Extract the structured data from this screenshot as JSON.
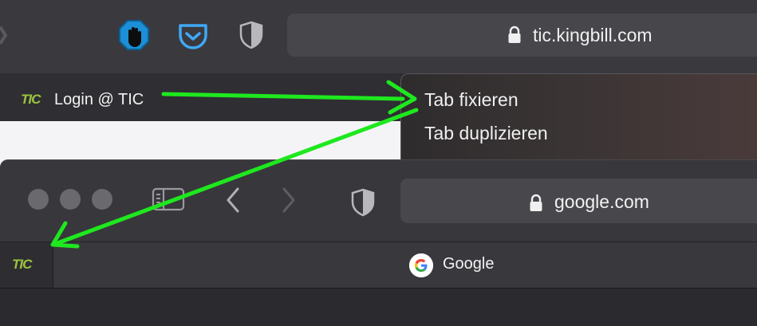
{
  "back_window": {
    "url": "tic.kingbill.com",
    "tab": {
      "favicon_text": "TIC",
      "title": "Login @ TIC"
    },
    "extensions": [
      "adblock-hand-icon",
      "pocket-icon",
      "privacy-shield-icon"
    ]
  },
  "context_menu": {
    "items": [
      {
        "label": "Tab fixieren"
      },
      {
        "label": "Tab duplizieren"
      }
    ]
  },
  "front_window": {
    "url": "google.com",
    "pinned_tab": {
      "favicon_text": "TIC"
    },
    "tab": {
      "title": "Google"
    }
  },
  "colors": {
    "annotation_arrow": "#1ee81e",
    "tic_green": "#9bc53d",
    "adblock_blue": "#1c8fd6",
    "pocket_blue": "#3fa9f5"
  }
}
